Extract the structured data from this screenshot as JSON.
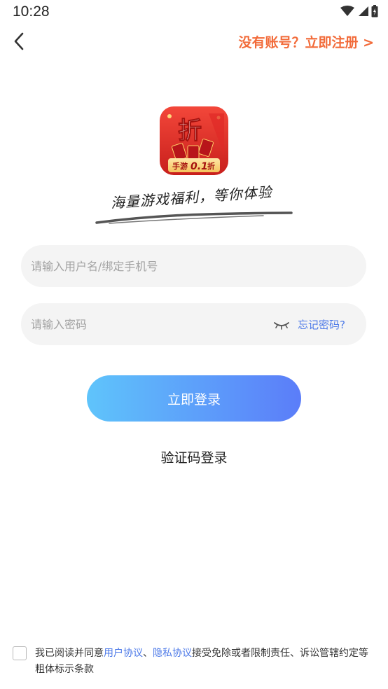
{
  "status_bar": {
    "time": "10:28",
    "icons": [
      "wifi-icon",
      "cellular-signal-icon",
      "battery-icon"
    ]
  },
  "header": {
    "back_icon": "chevron-left-icon",
    "register_link": "没有账号？立即注册 >"
  },
  "branding": {
    "logo_main_char": "折",
    "logo_tag_prefix": "手游",
    "logo_tag_number": "0.1",
    "logo_tag_suffix": "折",
    "slogan": "海量游戏福利，等你体验"
  },
  "form": {
    "username_placeholder": "请输入用户名/绑定手机号",
    "password_placeholder": "请输入密码",
    "eye_icon": "eye-closed-icon",
    "forgot_password": "忘记密码?",
    "login_button": "立即登录",
    "code_login": "验证码登录"
  },
  "agreement": {
    "prefix": "我已阅读并同意",
    "user_agreement": "用户协议",
    "separator": "、",
    "privacy_policy": "隐私协议",
    "suffix": "接受免除或者限制责任、诉讼管辖约定等粗体标示条款"
  },
  "colors": {
    "accent_orange": "#f26b3a",
    "link_blue": "#4c79e8",
    "button_gradient_start": "#5fc4fb",
    "button_gradient_end": "#5b7df9",
    "logo_red": "#e8322c"
  }
}
